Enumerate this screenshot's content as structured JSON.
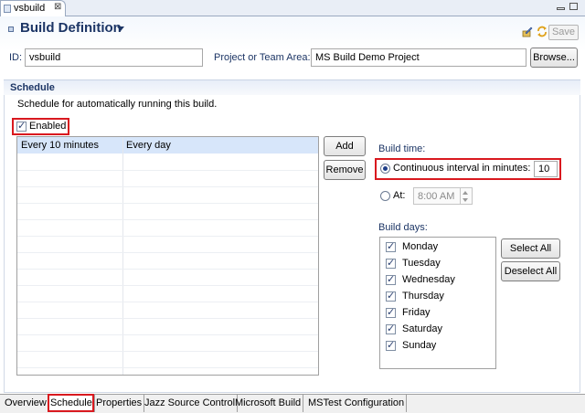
{
  "editor_tab": {
    "label": "vsbuild",
    "close": "⊠"
  },
  "header": {
    "title": "Build Definition",
    "save_label": "Save"
  },
  "id_row": {
    "id_label": "ID:",
    "id_value": "vsbuild",
    "project_label": "Project or Team Area:",
    "project_value": "MS Build Demo Project",
    "browse_label": "Browse..."
  },
  "schedule": {
    "title": "Schedule",
    "description": "Schedule for automatically running this build.",
    "enabled_label": "Enabled",
    "enabled_checked": true,
    "rows": [
      {
        "interval": "Every 10 minutes",
        "days": "Every day"
      }
    ],
    "add_label": "Add",
    "remove_label": "Remove",
    "build_time_label": "Build time:",
    "continuous_label": "Continuous interval in minutes:",
    "continuous_value": "10",
    "at_label": "At:",
    "at_value": "8:00 AM",
    "build_days_label": "Build days:",
    "days": [
      {
        "label": "Monday",
        "checked": true
      },
      {
        "label": "Tuesday",
        "checked": true
      },
      {
        "label": "Wednesday",
        "checked": true
      },
      {
        "label": "Thursday",
        "checked": true
      },
      {
        "label": "Friday",
        "checked": true
      },
      {
        "label": "Saturday",
        "checked": true
      },
      {
        "label": "Sunday",
        "checked": true
      }
    ],
    "select_all_label": "Select All",
    "deselect_all_label": "Deselect All"
  },
  "bottom_tabs": [
    {
      "label": "Overview"
    },
    {
      "label": "Schedule",
      "active": true
    },
    {
      "label": "Properties"
    },
    {
      "label": "Jazz Source Control"
    },
    {
      "label": "Microsoft Build"
    },
    {
      "label": "MSTest Configuration"
    }
  ],
  "colors": {
    "highlight": "#d9191f",
    "title": "#1c3565",
    "selection": "#d7e6fa"
  }
}
